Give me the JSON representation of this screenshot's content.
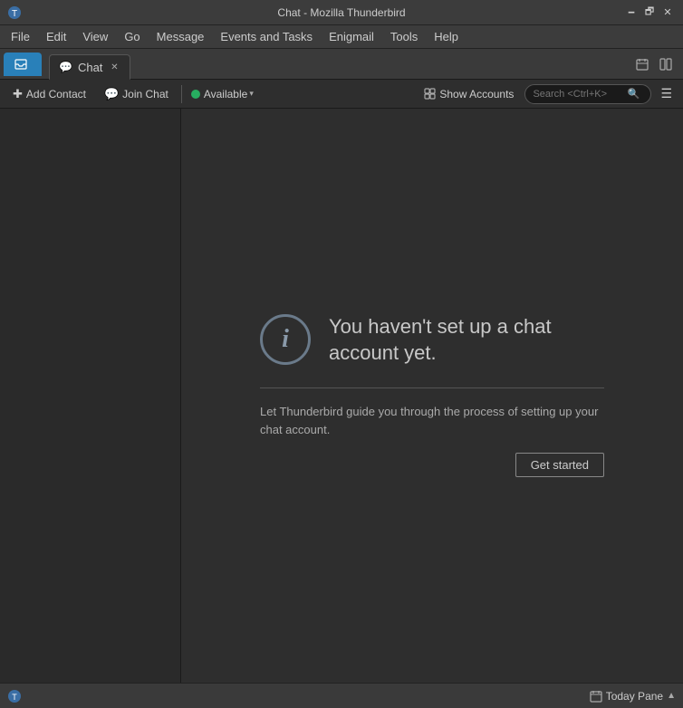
{
  "titlebar": {
    "title": "Chat - Mozilla Thunderbird",
    "minimize_label": "🗕",
    "maximize_label": "🗗",
    "close_label": "✕"
  },
  "menubar": {
    "items": [
      {
        "id": "file",
        "label": "File"
      },
      {
        "id": "edit",
        "label": "Edit"
      },
      {
        "id": "view",
        "label": "View"
      },
      {
        "id": "go",
        "label": "Go"
      },
      {
        "id": "message",
        "label": "Message"
      },
      {
        "id": "events_tasks",
        "label": "Events and Tasks"
      },
      {
        "id": "enigmail",
        "label": "Enigmail"
      },
      {
        "id": "tools",
        "label": "Tools"
      },
      {
        "id": "help",
        "label": "Help"
      }
    ]
  },
  "toolbar": {
    "chat_tab_label": "Chat",
    "chat_tab_icon": "💬"
  },
  "actionbar": {
    "add_contact_label": "Add Contact",
    "join_chat_label": "Join Chat",
    "status_text": "Available",
    "show_accounts_label": "Show Accounts",
    "search_placeholder": "Search <Ctrl+K>"
  },
  "chat_setup": {
    "title": "You haven't set up a chat account yet.",
    "description": "Let Thunderbird guide you through the process of setting up your chat account.",
    "get_started_label": "Get started"
  },
  "statusbar": {
    "today_pane_label": "Today Pane",
    "chevron": "▲"
  }
}
